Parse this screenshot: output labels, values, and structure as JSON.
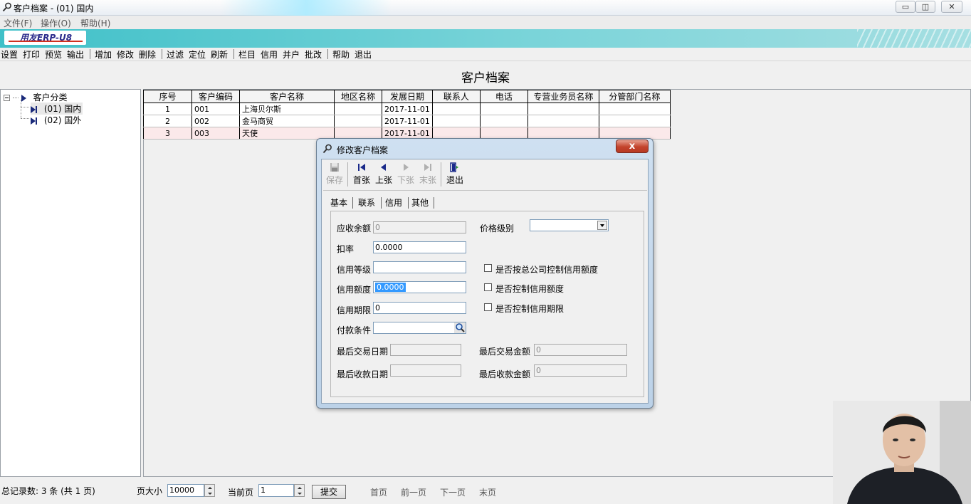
{
  "window": {
    "title": "客户档案 - (01) 国内",
    "minimize": "▭",
    "restore": "◫",
    "close": "✕"
  },
  "menu": [
    "文件(F)",
    "操作(O)",
    "帮助(H)"
  ],
  "brand": {
    "logo_text": "用友ERP-U8"
  },
  "toolbar": {
    "groups": [
      [
        "设置",
        "打印",
        "预览",
        "输出"
      ],
      [
        "增加",
        "修改",
        "删除"
      ],
      [
        "过滤",
        "定位",
        "刷新"
      ],
      [
        "栏目",
        "信用",
        "并户",
        "批改"
      ],
      [
        "帮助",
        "退出"
      ]
    ]
  },
  "page_title": "客户档案",
  "tree": {
    "root": "客户分类",
    "children": [
      "(01) 国内",
      "(02) 国外"
    ]
  },
  "grid": {
    "columns": [
      "序号",
      "客户编码",
      "客户名称",
      "地区名称",
      "发展日期",
      "联系人",
      "电话",
      "专营业务员名称",
      "分管部门名称"
    ],
    "rows": [
      [
        "1",
        "001",
        "上海贝尔斯",
        "",
        "2017-11-01",
        "",
        "",
        "",
        ""
      ],
      [
        "2",
        "002",
        "金马商贸",
        "",
        "2017-11-01",
        "",
        "",
        "",
        ""
      ],
      [
        "3",
        "003",
        "天使",
        "",
        "2017-11-01",
        "",
        "",
        "",
        ""
      ]
    ]
  },
  "dialog": {
    "title": "修改客户档案",
    "close_label": "x",
    "tools": {
      "save": "保存",
      "first": "首张",
      "prev": "上张",
      "next": "下张",
      "last": "末张",
      "exit": "退出"
    },
    "tabs": [
      "基本",
      "联系",
      "信用",
      "其他"
    ],
    "fields": {
      "receivable_label": "应收余额",
      "receivable_value": "0",
      "price_level_label": "价格级别",
      "price_level_value": "",
      "discount_label": "扣率",
      "discount_value": "0.0000",
      "credit_grade_label": "信用等级",
      "credit_grade_value": "",
      "credit_limit_label": "信用额度",
      "credit_limit_value": "0.0000",
      "credit_period_label": "信用期限",
      "credit_period_value": "0",
      "payment_terms_label": "付款条件",
      "payment_terms_value": "",
      "chk_group_control": "是否按总公司控制信用额度",
      "chk_limit_control": "是否控制信用额度",
      "chk_period_control": "是否控制信用期限",
      "last_trade_date_label": "最后交易日期",
      "last_trade_date_value": "",
      "last_trade_amount_label": "最后交易金额",
      "last_trade_amount_value": "0",
      "last_receipt_date_label": "最后收款日期",
      "last_receipt_date_value": "",
      "last_receipt_amount_label": "最后收款金额",
      "last_receipt_amount_value": "0"
    }
  },
  "status": {
    "total": "总记录数: 3 条 (共 1 页)",
    "page_size_label": "页大小",
    "page_size_value": "10000",
    "current_page_label": "当前页",
    "current_page_value": "1",
    "submit": "提交",
    "first": "首页",
    "prev": "前一页",
    "next": "下一页",
    "last": "末页"
  }
}
